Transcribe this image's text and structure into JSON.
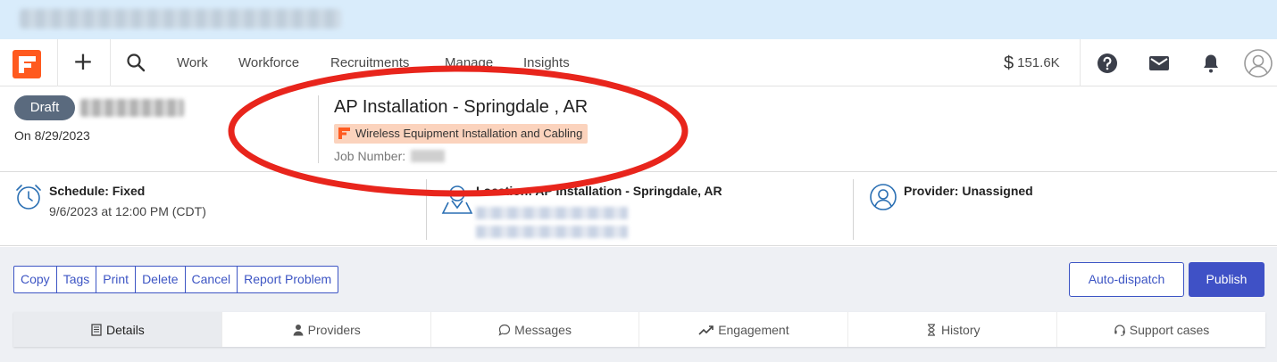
{
  "nav": {
    "links": [
      "Work",
      "Workforce",
      "Recruitments",
      "Manage",
      "Insights"
    ],
    "balance": "151.6K",
    "balance_icon": "$",
    "brand_color": "#ff5a1f"
  },
  "header": {
    "status_badge": "Draft",
    "date_text": "On 8/29/2023",
    "title": "AP Installation - Springdale , AR",
    "type_tag": "Wireless Equipment Installation and Cabling",
    "job_number_label": "Job Number:"
  },
  "info": {
    "schedule_title": "Schedule: Fixed",
    "schedule_detail": "9/6/2023 at 12:00 PM  (CDT)",
    "location_title": "Location: AP Installation - Springdale, AR",
    "provider_title": "Provider: Unassigned"
  },
  "actions": {
    "group": [
      "Copy",
      "Tags",
      "Print",
      "Delete",
      "Cancel",
      "Report Problem"
    ],
    "auto_dispatch": "Auto-dispatch",
    "publish": "Publish"
  },
  "tabs": [
    {
      "label": "Details",
      "icon": "document-icon",
      "active": true
    },
    {
      "label": "Providers",
      "icon": "person-icon",
      "active": false
    },
    {
      "label": "Messages",
      "icon": "chat-bubble-icon",
      "active": false
    },
    {
      "label": "Engagement",
      "icon": "trend-icon",
      "active": false
    },
    {
      "label": "History",
      "icon": "hourglass-icon",
      "active": false
    },
    {
      "label": "Support cases",
      "icon": "headset-icon",
      "active": false
    }
  ],
  "annotation_color": "#e8251c"
}
